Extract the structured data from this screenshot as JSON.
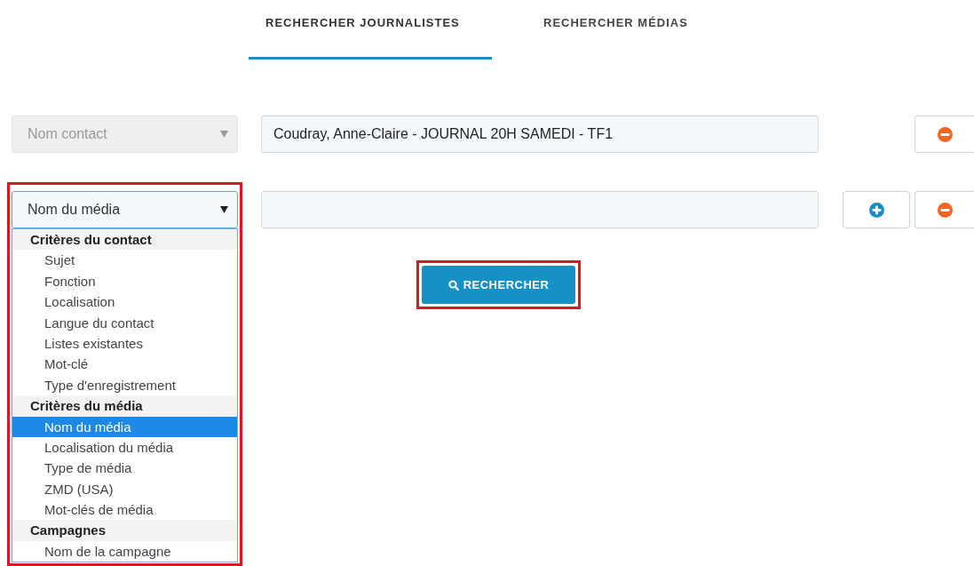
{
  "tabs": [
    {
      "label": "RECHERCHER JOURNALISTES",
      "selected": true
    },
    {
      "label": "RECHERCHER MÉDIAS",
      "selected": false
    }
  ],
  "criteria": [
    {
      "field": {
        "value": "Nom contact",
        "disabled": true,
        "open": false
      },
      "text": {
        "value": "Coudray, Anne-Claire - JOURNAL 20H SAMEDI - TF1"
      },
      "buttons": [
        {
          "kind": "remove"
        }
      ],
      "highlighted": false
    },
    {
      "field": {
        "value": "Nom du média",
        "disabled": false,
        "open": true
      },
      "buttons": [
        {
          "kind": "add"
        },
        {
          "kind": "remove"
        }
      ],
      "highlighted": true
    }
  ],
  "dropdown": {
    "groups": [
      {
        "label": "Critères du contact",
        "options": [
          {
            "label": "Sujet",
            "selected": false
          },
          {
            "label": "Fonction",
            "selected": false
          },
          {
            "label": "Localisation",
            "selected": false
          },
          {
            "label": "Langue du contact",
            "selected": false
          },
          {
            "label": "Listes existantes",
            "selected": false
          },
          {
            "label": "Mot-clé",
            "selected": false
          },
          {
            "label": "Type d'enregistrement",
            "selected": false
          }
        ]
      },
      {
        "label": "Critères du média",
        "options": [
          {
            "label": "Nom du média",
            "selected": true
          },
          {
            "label": "Localisation du média",
            "selected": false
          },
          {
            "label": "Type de média",
            "selected": false
          },
          {
            "label": "ZMD (USA)",
            "selected": false
          },
          {
            "label": "Mot-clés de média",
            "selected": false
          }
        ]
      },
      {
        "label": "Campagnes",
        "options": [
          {
            "label": "Nom de la campagne",
            "selected": false
          }
        ]
      }
    ]
  },
  "search_button": {
    "label": "RECHERCHER",
    "highlighted": true
  }
}
